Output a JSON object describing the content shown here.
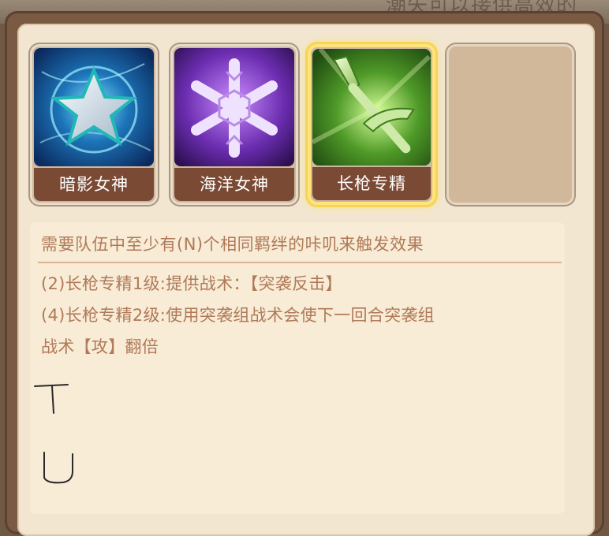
{
  "background_caption": "潮失可以接供高效的",
  "slots": [
    {
      "label": "暗影女神",
      "icon": "star-icon",
      "selected": false
    },
    {
      "label": "海洋女神",
      "icon": "snowflake-icon",
      "selected": false
    },
    {
      "label": "长枪专精",
      "icon": "spear-icon",
      "selected": true
    },
    {
      "label": "",
      "icon": "",
      "selected": false
    }
  ],
  "description": {
    "requirement": "需要队伍中至少有(N)个相同羁绊的咔叽来触发效果",
    "tier1": "(2)长枪专精1级:提供战术：【突袭反击】",
    "tier2_line1": "(4)长枪专精2级:使用突袭组战术会使下一回合突袭组",
    "tier2_line2": "战术【攻】翻倍"
  },
  "colors": {
    "frame": "#7a5a42",
    "parchment": "#f2e6d1",
    "label_bg": "#7b4a34",
    "text": "#b07958",
    "selected_glow": "#ffe47a"
  }
}
